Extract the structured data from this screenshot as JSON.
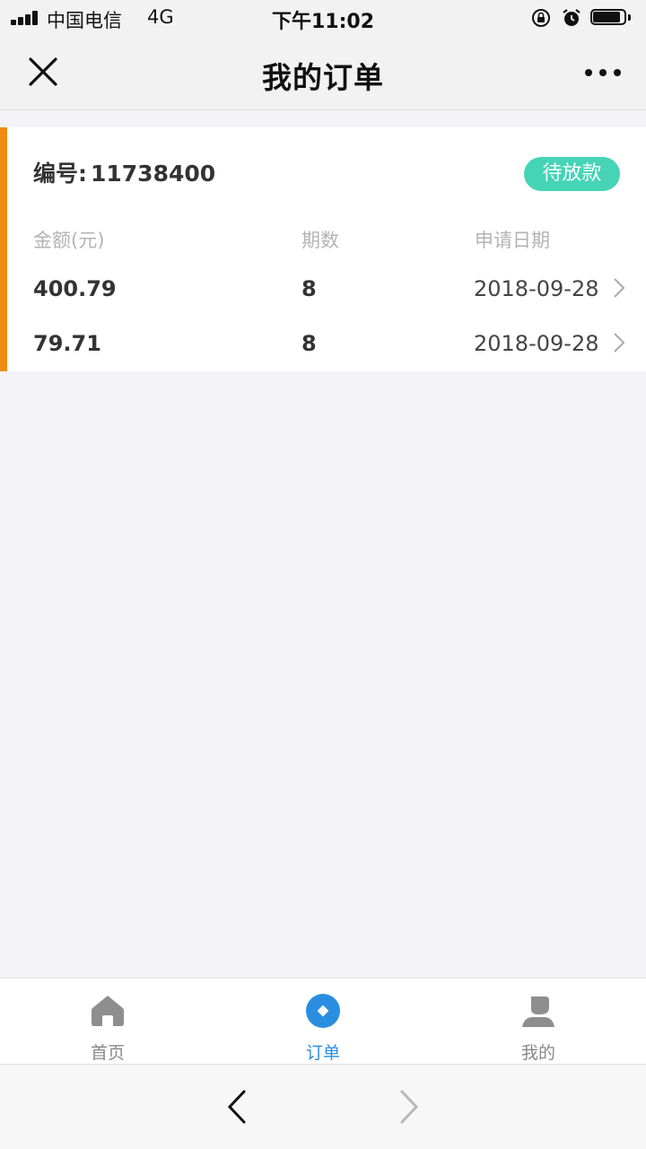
{
  "status_bar": {
    "carrier": "中国电信",
    "network": "4G",
    "time": "下午11:02"
  },
  "nav": {
    "title": "我的订单"
  },
  "order": {
    "number_label": "编号:",
    "number": "11738400",
    "status": "待放款",
    "columns": [
      "金额(元)",
      "期数",
      "申请日期"
    ],
    "rows": [
      {
        "amount": "400.79",
        "periods": "8",
        "date": "2018-09-28"
      },
      {
        "amount": "79.71",
        "periods": "8",
        "date": "2018-09-28"
      }
    ]
  },
  "tabs": [
    {
      "label": "首页",
      "icon": "home-icon",
      "active": false
    },
    {
      "label": "订单",
      "icon": "order-icon",
      "active": true
    },
    {
      "label": "我的",
      "icon": "profile-icon",
      "active": false
    }
  ],
  "colors": {
    "accent": "#f08a13",
    "status_badge": "#45d4b6",
    "active_tab": "#2a8ee0"
  }
}
